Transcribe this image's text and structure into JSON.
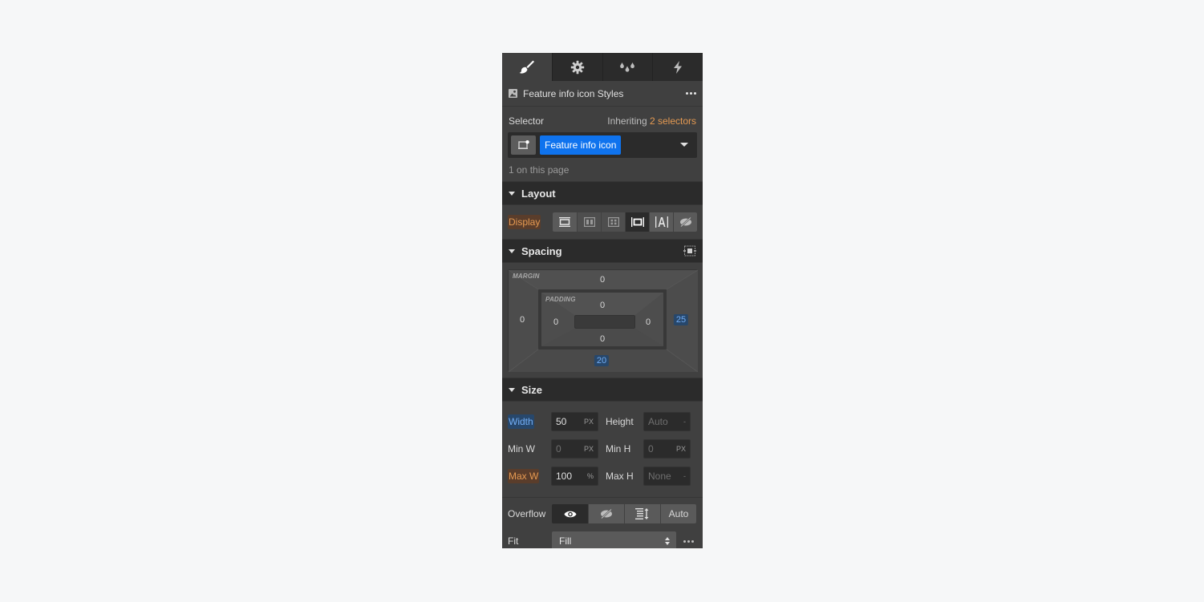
{
  "tabs": [
    {
      "name": "style",
      "icon": "paintbrush-icon",
      "active": true
    },
    {
      "name": "settings",
      "icon": "gear-icon",
      "active": false
    },
    {
      "name": "style-manager",
      "icon": "drops-icon",
      "active": false
    },
    {
      "name": "interactions",
      "icon": "lightning-icon",
      "active": false
    }
  ],
  "header": {
    "title": "Feature info icon Styles",
    "icon": "image-icon",
    "more_icon": "more-dots-icon"
  },
  "selector": {
    "label": "Selector",
    "inheriting_prefix": "Inheriting",
    "inheriting_count": "2 selectors",
    "chip": "Feature info icon",
    "usage": "1 on this page"
  },
  "layout": {
    "title": "Layout",
    "display_label": "Display",
    "display_options": [
      {
        "name": "block",
        "icon": "display-block-icon"
      },
      {
        "name": "flex",
        "icon": "display-flex-icon"
      },
      {
        "name": "grid",
        "icon": "display-grid-icon"
      },
      {
        "name": "inline-block",
        "icon": "display-inline-block-icon",
        "selected": true
      },
      {
        "name": "inline",
        "icon": "display-inline-icon"
      },
      {
        "name": "none",
        "icon": "display-none-icon"
      }
    ]
  },
  "spacing": {
    "title": "Spacing",
    "margin_label": "MARGIN",
    "padding_label": "PADDING",
    "margin": {
      "top": "0",
      "right": "25",
      "bottom": "20",
      "left": "0"
    },
    "padding": {
      "top": "0",
      "right": "0",
      "bottom": "0",
      "left": "0"
    }
  },
  "size": {
    "title": "Size",
    "width": {
      "label": "Width",
      "value": "50",
      "unit": "PX"
    },
    "height": {
      "label": "Height",
      "value": "Auto",
      "unit": "-"
    },
    "min_w": {
      "label": "Min W",
      "value": "0",
      "unit": "PX"
    },
    "min_h": {
      "label": "Min H",
      "value": "0",
      "unit": "PX"
    },
    "max_w": {
      "label": "Max W",
      "value": "100",
      "unit": "%"
    },
    "max_h": {
      "label": "Max H",
      "value": "None",
      "unit": "-"
    },
    "overflow_label": "Overflow",
    "overflow_options": [
      {
        "name": "visible",
        "icon": "eye-icon",
        "selected": true
      },
      {
        "name": "hidden",
        "icon": "eye-slash-icon"
      },
      {
        "name": "scroll",
        "icon": "scroll-icon"
      },
      {
        "name": "auto",
        "label": "Auto"
      }
    ],
    "fit_label": "Fit",
    "fit_value": "Fill"
  }
}
